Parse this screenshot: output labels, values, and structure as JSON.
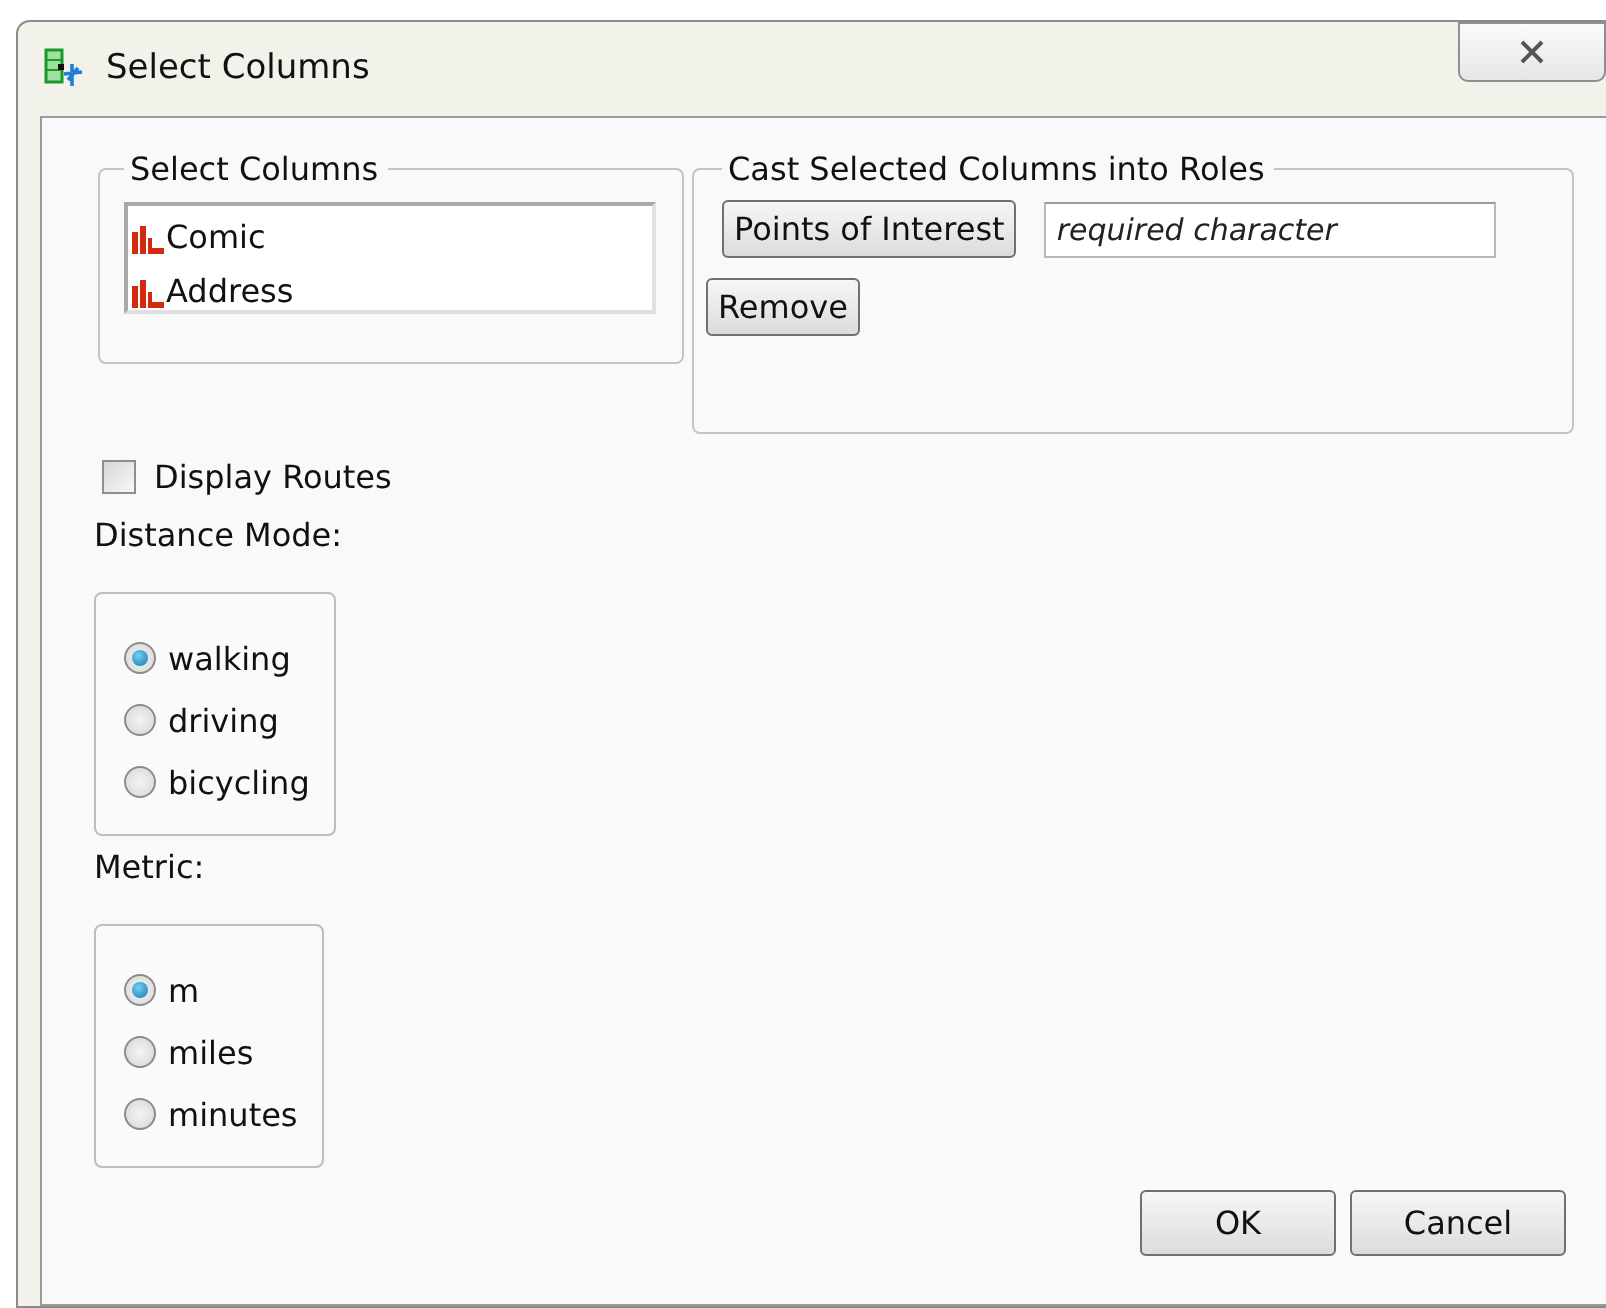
{
  "window": {
    "title": "Select Columns"
  },
  "select_columns": {
    "title": "Select Columns",
    "items": [
      {
        "label": "Comic"
      },
      {
        "label": "Address"
      }
    ]
  },
  "cast_roles": {
    "title": "Cast Selected Columns into Roles",
    "role_button": "Points of Interest",
    "role_field": {
      "placeholder": "required character"
    },
    "remove_button": "Remove"
  },
  "display_routes": {
    "label": "Display Routes",
    "checked": false
  },
  "distance_mode": {
    "label": "Distance Mode:",
    "options": [
      {
        "label": "walking",
        "selected": true
      },
      {
        "label": "driving",
        "selected": false
      },
      {
        "label": "bicycling",
        "selected": false
      }
    ]
  },
  "metric": {
    "label": "Metric:",
    "options": [
      {
        "label": "m",
        "selected": true
      },
      {
        "label": "miles",
        "selected": false
      },
      {
        "label": "minutes",
        "selected": false
      }
    ]
  },
  "buttons": [
    "OK",
    "Cancel"
  ]
}
